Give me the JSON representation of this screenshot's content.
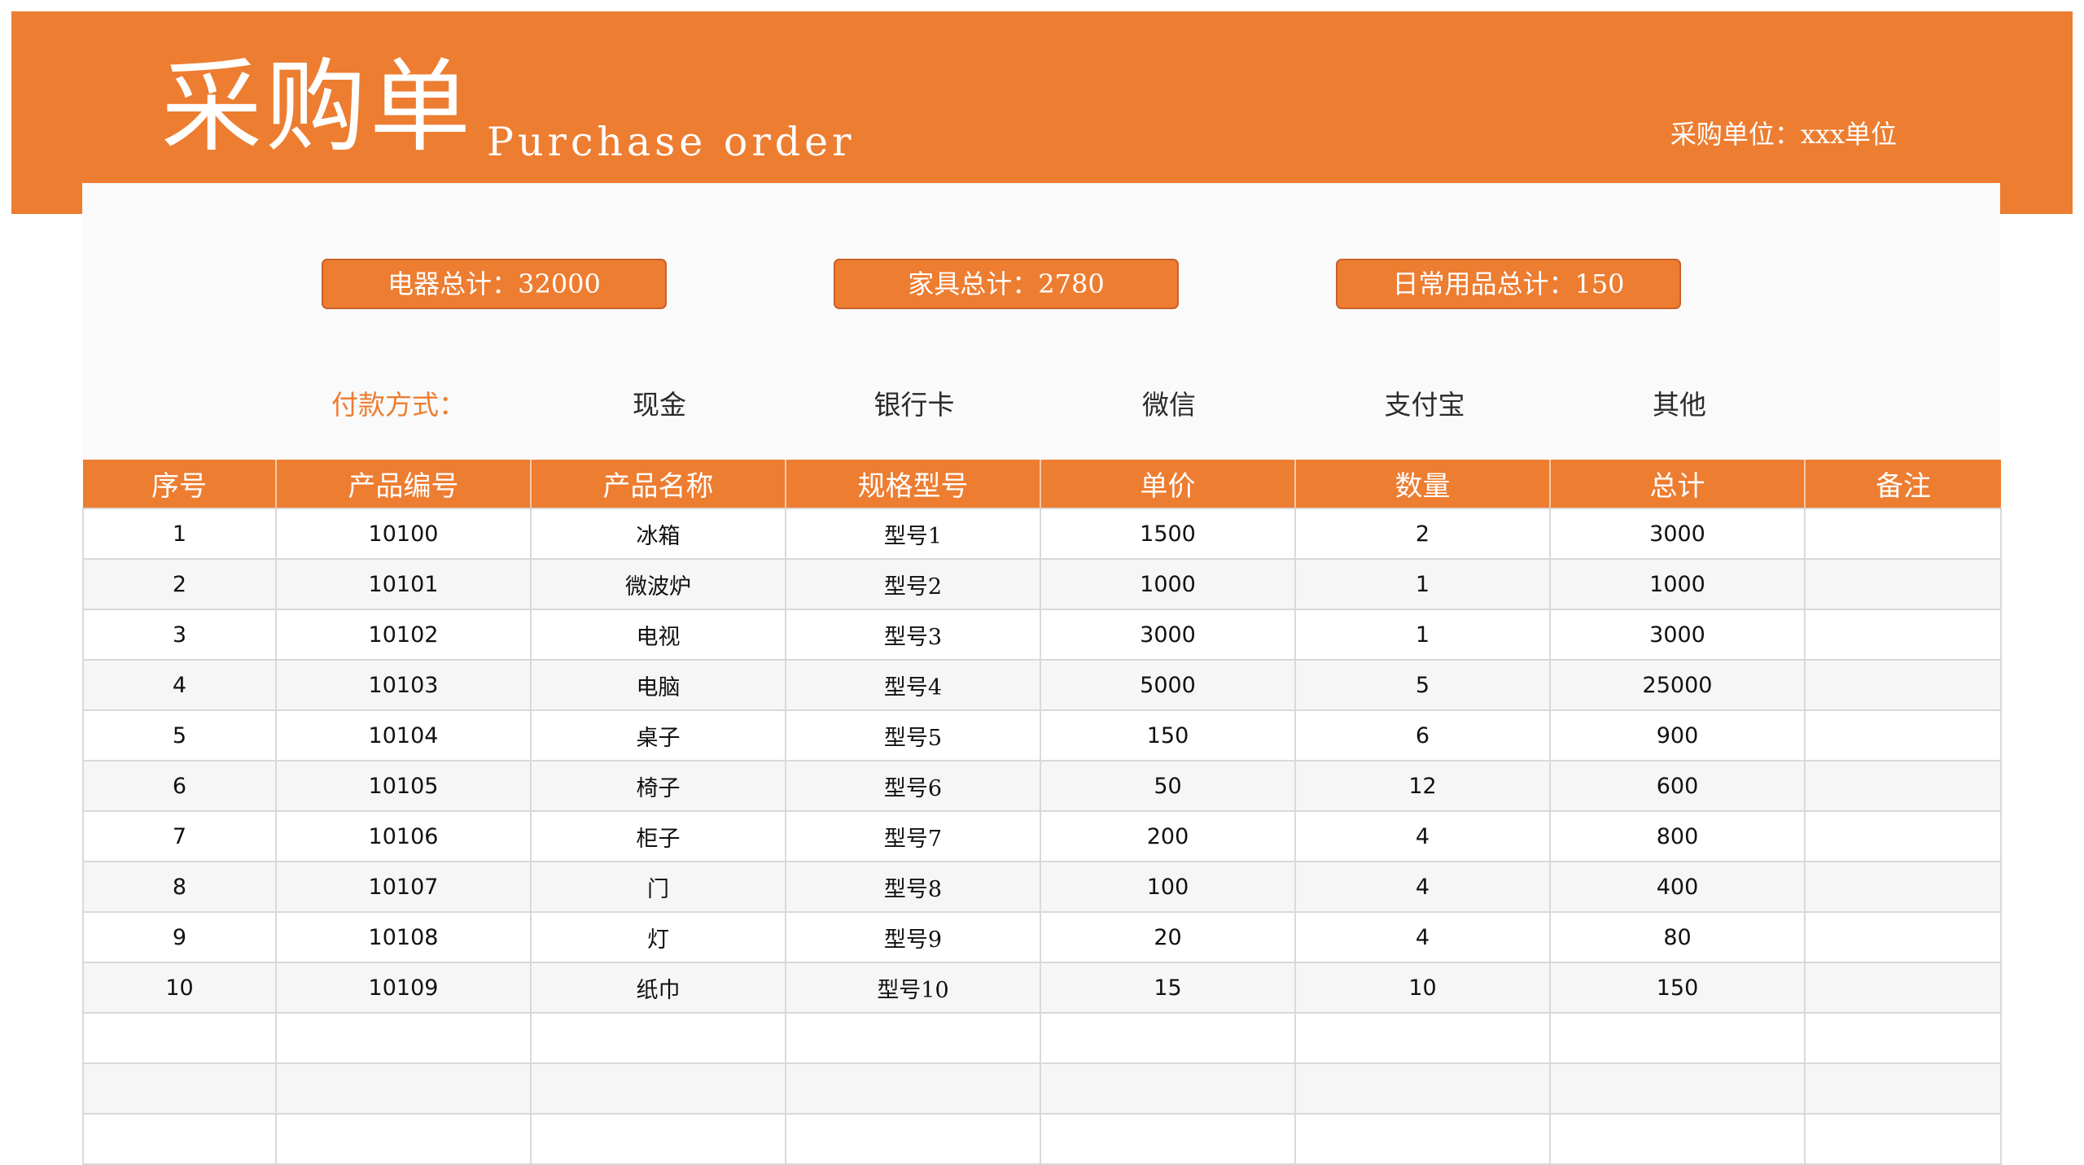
{
  "header": {
    "title_zh": "采购单",
    "title_en": "Purchase order",
    "unit": "采购单位：xxx单位"
  },
  "totals": [
    {
      "label": "电器总计：32000"
    },
    {
      "label": "家具总计：2780"
    },
    {
      "label": "日常用品总计：150"
    }
  ],
  "payment": {
    "label": "付款方式：",
    "options": [
      "现金",
      "银行卡",
      "微信",
      "支付宝",
      "其他"
    ]
  },
  "table": {
    "columns": [
      "序号",
      "产品编号",
      "产品名称",
      "规格型号",
      "单价",
      "数量",
      "总计",
      "备注"
    ],
    "rows": [
      [
        "1",
        "10100",
        "冰箱",
        "型号1",
        "1500",
        "2",
        "3000",
        ""
      ],
      [
        "2",
        "10101",
        "微波炉",
        "型号2",
        "1000",
        "1",
        "1000",
        ""
      ],
      [
        "3",
        "10102",
        "电视",
        "型号3",
        "3000",
        "1",
        "3000",
        ""
      ],
      [
        "4",
        "10103",
        "电脑",
        "型号4",
        "5000",
        "5",
        "25000",
        ""
      ],
      [
        "5",
        "10104",
        "桌子",
        "型号5",
        "150",
        "6",
        "900",
        ""
      ],
      [
        "6",
        "10105",
        "椅子",
        "型号6",
        "50",
        "12",
        "600",
        ""
      ],
      [
        "7",
        "10106",
        "柜子",
        "型号7",
        "200",
        "4",
        "800",
        ""
      ],
      [
        "8",
        "10107",
        "门",
        "型号8",
        "100",
        "4",
        "400",
        ""
      ],
      [
        "9",
        "10108",
        "灯",
        "型号9",
        "20",
        "4",
        "80",
        ""
      ],
      [
        "10",
        "10109",
        "纸巾",
        "型号10",
        "15",
        "10",
        "150",
        ""
      ],
      [
        "",
        "",
        "",
        "",
        "",
        "",
        "",
        ""
      ],
      [
        "",
        "",
        "",
        "",
        "",
        "",
        "",
        ""
      ],
      [
        "",
        "",
        "",
        "",
        "",
        "",
        "",
        ""
      ]
    ]
  },
  "colors": {
    "accent": "#ed7d31",
    "sheet_background": "#fafafa",
    "grid_line": "#d9d9d9"
  }
}
